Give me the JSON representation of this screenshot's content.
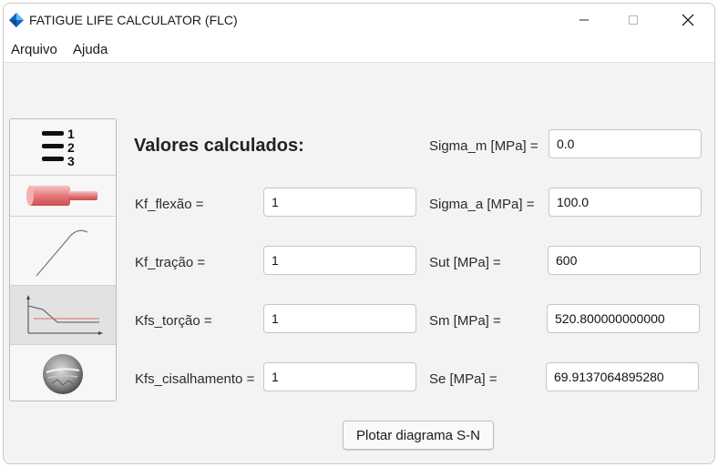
{
  "window": {
    "title": "FATIGUE LIFE CALCULATOR (FLC)"
  },
  "menu": [
    {
      "label": "Arquivo"
    },
    {
      "label": "Ajuda"
    }
  ],
  "sidebar": {
    "items": [
      {
        "icon": "numbered-list-icon"
      },
      {
        "icon": "shaft-icon"
      },
      {
        "icon": "stress-strain-curve-icon"
      },
      {
        "icon": "sn-diagram-icon",
        "selected": true
      },
      {
        "icon": "fracture-surface-icon"
      }
    ]
  },
  "main": {
    "heading": "Valores calculados:",
    "left_fields": [
      {
        "label": "Kf_flexão =",
        "value": "1"
      },
      {
        "label": "Kf_tração =",
        "value": "1"
      },
      {
        "label": "Kfs_torção =",
        "value": "1"
      },
      {
        "label": "Kfs_cisalhamento =",
        "value": "1"
      }
    ],
    "right_fields": [
      {
        "label": "Sigma_m [MPa] =",
        "value": "0.0"
      },
      {
        "label": "Sigma_a [MPa] =",
        "value": "100.0"
      },
      {
        "label": "Sut [MPa] =",
        "value": "600"
      },
      {
        "label": "Sm [MPa] =",
        "value": "520.800000000000"
      },
      {
        "label": "Se [MPa] =",
        "value": "69.9137064895280"
      }
    ],
    "plot_button": "Plotar diagrama S-N"
  },
  "colors": {
    "accent": "#1e88e5",
    "shaft": "#e77a7a",
    "curve_line": "#e26a6a"
  }
}
